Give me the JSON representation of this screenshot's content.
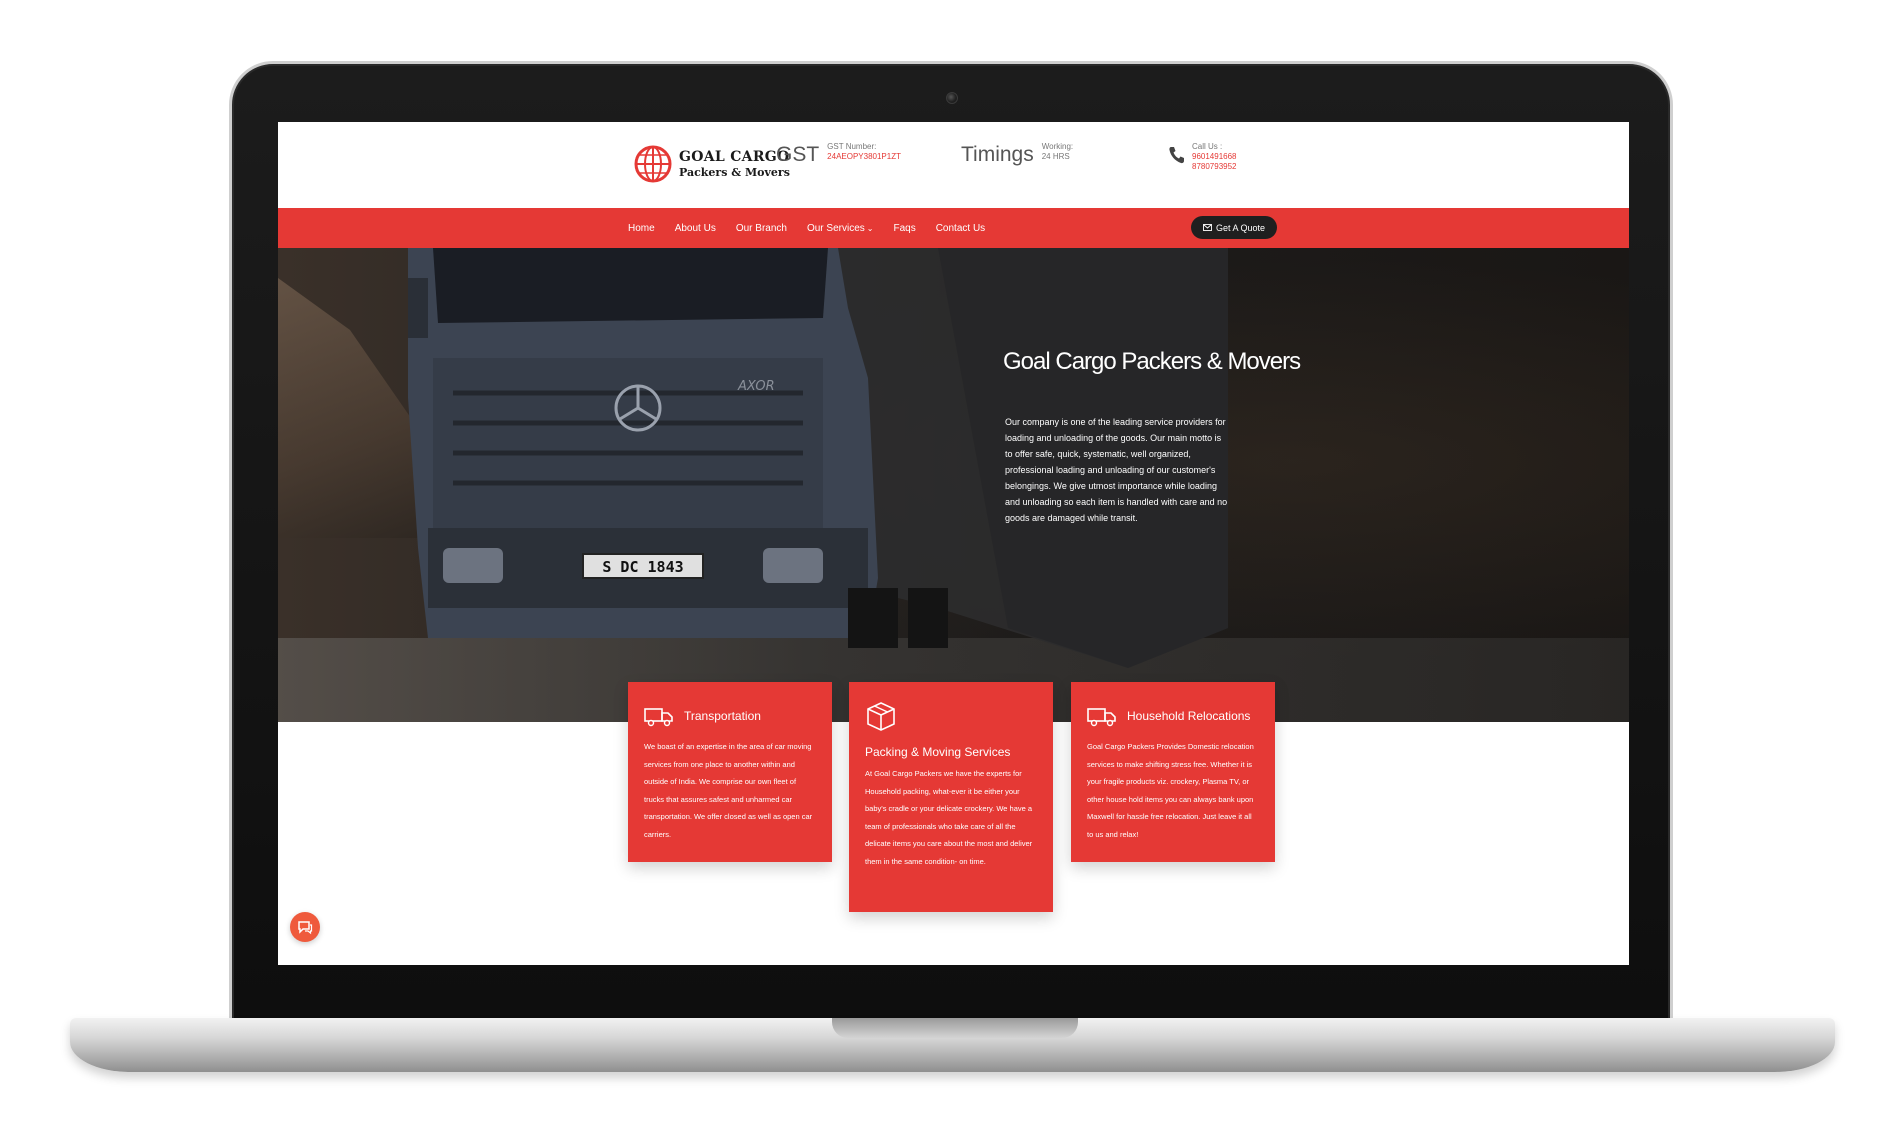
{
  "header": {
    "logo_line1": "GOAL CARGO",
    "logo_line2": "Packers & Movers",
    "gst": {
      "big": "GST",
      "label": "GST Number:",
      "value": "24AEOPY3801P1ZT"
    },
    "timings": {
      "big": "Timings",
      "label": "Working:",
      "value": "24 HRS"
    },
    "call": {
      "label": "Call Us :",
      "phone1": "9601491668",
      "phone2": "8780793952"
    }
  },
  "nav": {
    "items": [
      "Home",
      "About Us",
      "Our Branch",
      "Our Services",
      "Faqs",
      "Contact Us"
    ],
    "services_chevron": "⌄",
    "quote_label": "Get A Quote"
  },
  "hero": {
    "title": "Goal Cargo Packers & Movers",
    "text": "Our company is one of the leading service providers for loading and unloading of the goods. Our main motto is to offer safe, quick, systematic, well organized, professional loading and unloading of our customer's belongings. We give utmost importance while loading and unloading so each item is handled with care and no goods are damaged while transit.",
    "plate": "S DC 1843",
    "model": "AXOR"
  },
  "cards": [
    {
      "title": "Transportation",
      "icon": "truck-icon",
      "text": "We boast of an expertise in the area of car moving services from one place to another within and outside of India. We comprise our own fleet of trucks that assures safest and unharmed car transportation. We offer closed as well as open car carriers."
    },
    {
      "title": "Packing & Moving Services",
      "icon": "box-icon",
      "text": "At Goal Cargo Packers we have the experts for Household packing, what-ever it be either your baby's cradle or your delicate crockery. We have a team of professionals who take care of all the delicate items you care about the most and deliver them in the same condition- on time."
    },
    {
      "title": "Household Relocations",
      "icon": "truck-icon",
      "text": "Goal Cargo Packers Provides Domestic relocation services to make shifting stress free. Whether it is your fragile products viz. crockery, Plasma TV, or other house hold items you can always bank upon Maxwell for hassle free relocation. Just leave it all to us and relax!"
    }
  ],
  "colors": {
    "accent": "#e53935",
    "dark": "#1f1f1f"
  }
}
